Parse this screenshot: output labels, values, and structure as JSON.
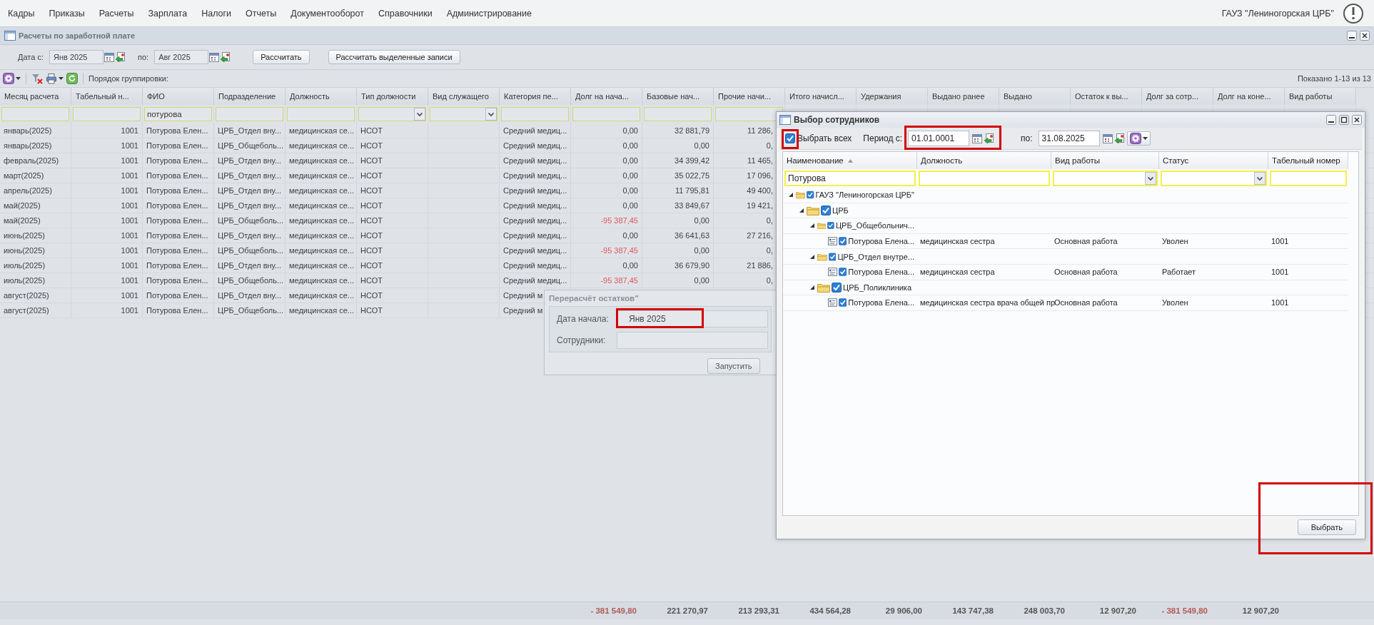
{
  "menu": [
    "Кадры",
    "Приказы",
    "Расчеты",
    "Зарплата",
    "Налоги",
    "Отчеты",
    "Документооборот",
    "Справочники",
    "Администрирование"
  ],
  "organization": "ГАУЗ \"Лениногорская ЦРБ\"",
  "panel": {
    "title": "Расчеты по заработной плате",
    "date_from_label": "Дата с:",
    "date_from": "Янв 2025",
    "date_to_label": "по:",
    "date_to": "Авг 2025",
    "buttons": [
      "Рассчитать",
      "Рассчитать выделенные записи"
    ],
    "grouping_label": "Порядок группировки:",
    "shown": "Показано 1-13 из 13"
  },
  "table": {
    "columns": [
      {
        "label": "Месяц расчета",
        "kind": "text"
      },
      {
        "label": "Табельный н...",
        "kind": "number"
      },
      {
        "label": "ФИО",
        "kind": "text"
      },
      {
        "label": "Подразделение",
        "kind": "text"
      },
      {
        "label": "Должность",
        "kind": "text"
      },
      {
        "label": "Тип должности",
        "kind": "text"
      },
      {
        "label": "Вид служащего",
        "kind": "text"
      },
      {
        "label": "Категория пе...",
        "kind": "text"
      },
      {
        "label": "Долг на нача...",
        "kind": "debt"
      },
      {
        "label": "Базовые нач...",
        "kind": "number"
      },
      {
        "label": "Прочие начи...",
        "kind": "number"
      },
      {
        "label": "Итого начисл..."
      },
      {
        "label": "Удержания"
      },
      {
        "label": "Выдано ранее"
      },
      {
        "label": "Выдано"
      },
      {
        "label": "Остаток к вы..."
      },
      {
        "label": "Долг за сотр..."
      },
      {
        "label": "Долг на коне..."
      },
      {
        "label": "Вид работы"
      }
    ],
    "filters": [
      {
        "kind": "text"
      },
      {
        "kind": "text"
      },
      {
        "kind": "text",
        "value": "потурова"
      },
      {
        "kind": "text"
      },
      {
        "kind": "text"
      },
      {
        "kind": "combo"
      },
      {
        "kind": "combo"
      },
      {
        "kind": "text"
      },
      {
        "kind": "text"
      },
      {
        "kind": "text"
      },
      {
        "kind": "text"
      }
    ],
    "rows": [
      {
        "cells": [
          "январь(2025)",
          "1001",
          "Потурова Елен...",
          "ЦРБ_Отдел вну...",
          "медицинская се...",
          "НСОТ",
          null,
          "Средний медиц...",
          "0,00",
          "32 881,79",
          "11 286,"
        ],
        "negative_debt": false
      },
      {
        "cells": [
          "январь(2025)",
          "1001",
          "Потурова Елен...",
          "ЦРБ_Общеболь...",
          "медицинская се...",
          "НСОТ",
          null,
          "Средний медиц...",
          "0,00",
          "0,00",
          "0,"
        ],
        "negative_debt": false
      },
      {
        "cells": [
          "февраль(2025)",
          "1001",
          "Потурова Елен...",
          "ЦРБ_Отдел вну...",
          "медицинская се...",
          "НСОТ",
          null,
          "Средний медиц...",
          "0,00",
          "34 399,42",
          "11 465,"
        ],
        "negative_debt": false
      },
      {
        "cells": [
          "март(2025)",
          "1001",
          "Потурова Елен...",
          "ЦРБ_Отдел вну...",
          "медицинская се...",
          "НСОТ",
          null,
          "Средний медиц...",
          "0,00",
          "35 022,75",
          "17 096,"
        ],
        "negative_debt": false
      },
      {
        "cells": [
          "апрель(2025)",
          "1001",
          "Потурова Елен...",
          "ЦРБ_Отдел вну...",
          "медицинская се...",
          "НСОТ",
          null,
          "Средний медиц...",
          "0,00",
          "11 795,81",
          "49 400,"
        ],
        "negative_debt": false
      },
      {
        "cells": [
          "май(2025)",
          "1001",
          "Потурова Елен...",
          "ЦРБ_Отдел вну...",
          "медицинская се...",
          "НСОТ",
          null,
          "Средний медиц...",
          "0,00",
          "33 849,67",
          "19 421,"
        ],
        "negative_debt": false
      },
      {
        "cells": [
          "май(2025)",
          "1001",
          "Потурова Елен...",
          "ЦРБ_Общеболь...",
          "медицинская се...",
          "НСОТ",
          null,
          "Средний медиц...",
          "-95 387,45",
          "0,00",
          "0,"
        ],
        "negative_debt": true
      },
      {
        "cells": [
          "июнь(2025)",
          "1001",
          "Потурова Елен...",
          "ЦРБ_Отдел вну...",
          "медицинская се...",
          "НСОТ",
          null,
          "Средний медиц...",
          "0,00",
          "36 641,63",
          "27 216,"
        ],
        "negative_debt": false
      },
      {
        "cells": [
          "июнь(2025)",
          "1001",
          "Потурова Елен...",
          "ЦРБ_Общеболь...",
          "медицинская се...",
          "НСОТ",
          null,
          "Средний медиц...",
          "-95 387,45",
          "0,00",
          "0,"
        ],
        "negative_debt": true
      },
      {
        "cells": [
          "июль(2025)",
          "1001",
          "Потурова Елен...",
          "ЦРБ_Отдел вну...",
          "медицинская се...",
          "НСОТ",
          null,
          "Средний медиц...",
          "0,00",
          "36 679,90",
          "21 886,"
        ],
        "negative_debt": false
      },
      {
        "cells": [
          "июль(2025)",
          "1001",
          "Потурова Елен...",
          "ЦРБ_Общеболь...",
          "медицинская се...",
          "НСОТ",
          null,
          "Средний медиц...",
          "-95 387,45",
          "0,00",
          "0,"
        ],
        "negative_debt": true
      },
      {
        "cells": [
          "август(2025)",
          "1001",
          "Потурова Елен...",
          "ЦРБ_Отдел вну...",
          "медицинская се...",
          "НСОТ",
          null,
          "Средний м"
        ]
      },
      {
        "cells": [
          "август(2025)",
          "1001",
          "Потурова Елен...",
          "ЦРБ_Общеболь...",
          "медицинская се...",
          "НСОТ",
          null,
          "Средний м"
        ]
      }
    ],
    "totals": [
      {
        "text": "- 381 549,80",
        "negative": true
      },
      {
        "text": "221 270,97",
        "negative": false
      },
      {
        "text": "213 293,31",
        "negative": false
      },
      {
        "text": "434 564,28",
        "negative": false
      },
      {
        "text": "29 906,00",
        "negative": false
      },
      {
        "text": "143 747,38",
        "negative": false
      },
      {
        "text": "248 003,70",
        "negative": false
      },
      {
        "text": "12 907,20",
        "negative": false
      },
      {
        "text": "- 381 549,80",
        "negative": true
      },
      {
        "text": "12 907,20",
        "negative": false
      }
    ]
  },
  "recalc_dialog": {
    "title": "Перерасчёт остатков\"",
    "fields": [
      {
        "label": "Дата начала:",
        "value": "Янв 2025",
        "highlighted": true
      },
      {
        "label": "Сотрудники:",
        "highlighted": false
      }
    ],
    "buttons": [
      "Запустить"
    ]
  },
  "employee_dialog": {
    "title": "Выбор сотрудников",
    "select_all": {
      "label": "Выбрать всех",
      "checked": true,
      "highlighted": true
    },
    "period_from_label": "Период с:",
    "period_from": {
      "value": "01.01.0001",
      "highlighted": true
    },
    "period_to_label": "по:",
    "period_to": "31.08.2025",
    "columns": [
      {
        "label": "Наименование",
        "sorted": true
      },
      {
        "label": "Должность",
        "sorted": false
      },
      {
        "label": "Вид работы",
        "sorted": false
      },
      {
        "label": "Статус",
        "sorted": false
      },
      {
        "label": "Табельный номер",
        "sorted": false
      }
    ],
    "filters": [
      {
        "kind": "text",
        "value": "Потурова"
      },
      {
        "kind": "text"
      },
      {
        "kind": "combo"
      },
      {
        "kind": "combo"
      },
      {
        "kind": "text"
      }
    ],
    "tree": [
      {
        "kind": "folder",
        "name": "ГАУЗ \"Лениногорская ЦРБ\"",
        "expanded": true,
        "checked": true,
        "children": [
          {
            "kind": "folder",
            "name": "ЦРБ",
            "expanded": true,
            "checked": true,
            "children": [
              {
                "kind": "folder",
                "name": "ЦРБ_Общебольнич...",
                "expanded": true,
                "checked": true,
                "children": [
                  {
                    "kind": "employee",
                    "name": "Потурова Елена...",
                    "checked": true,
                    "position": "медицинская сестра",
                    "work_type": "Основная работа",
                    "status": "Уволен",
                    "tab_number": "1001"
                  }
                ]
              },
              {
                "kind": "folder",
                "name": "ЦРБ_Отдел внутре...",
                "expanded": true,
                "checked": true,
                "children": [
                  {
                    "kind": "employee",
                    "name": "Потурова Елена...",
                    "checked": true,
                    "position": "медицинская сестра",
                    "work_type": "Основная работа",
                    "status": "Работает",
                    "tab_number": "1001"
                  }
                ]
              },
              {
                "kind": "folder",
                "name": "ЦРБ_Поликлиника",
                "expanded": true,
                "checked": true,
                "children": [
                  {
                    "kind": "employee",
                    "name": "Потурова Елена...",
                    "checked": true,
                    "position": "медицинская сестра врача общей пр",
                    "work_type": "Основная работа",
                    "status": "Уволен",
                    "tab_number": "1001"
                  }
                ]
              }
            ]
          }
        ]
      }
    ],
    "select_button": {
      "label": "Выбрать",
      "highlighted": true
    }
  }
}
